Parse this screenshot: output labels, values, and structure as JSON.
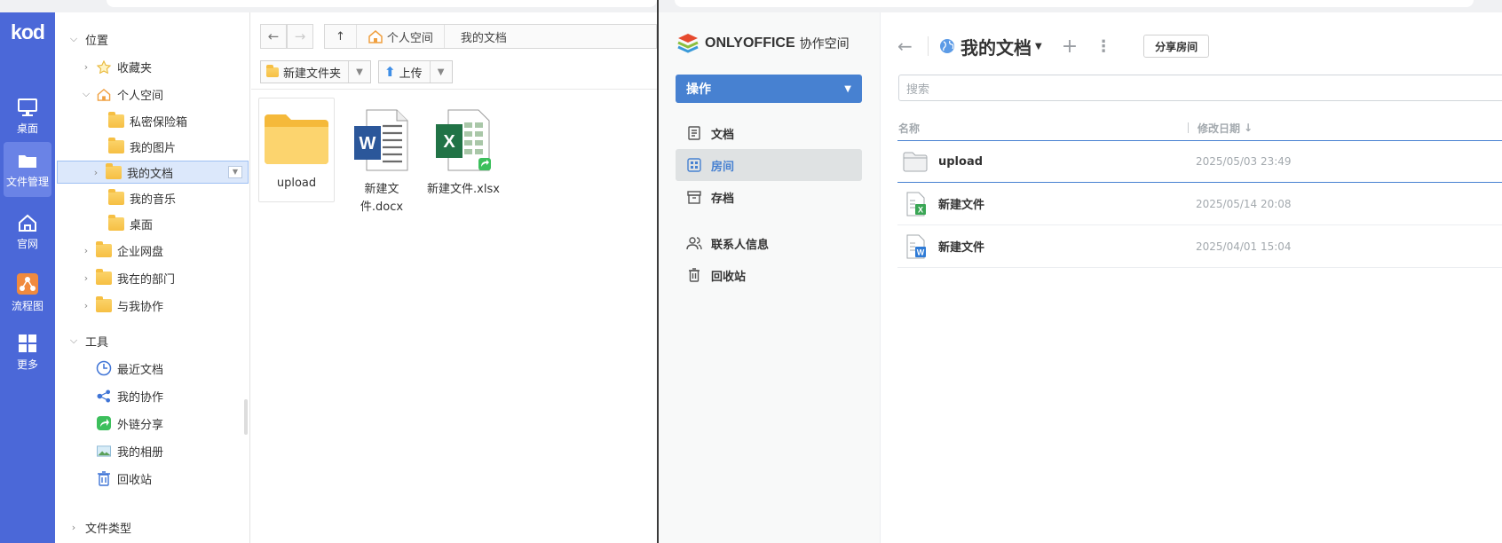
{
  "rail": {
    "logo": "kod",
    "items": [
      {
        "label": "桌面",
        "icon": "monitor-icon"
      },
      {
        "label": "文件管理",
        "icon": "folder-icon"
      },
      {
        "label": "官网",
        "icon": "home-icon"
      },
      {
        "label": "流程图",
        "icon": "flowchart-icon"
      },
      {
        "label": "更多",
        "icon": "grid-icon"
      }
    ]
  },
  "tree": {
    "location_header": "位置",
    "favorites": "收藏夹",
    "personal_space": "个人空间",
    "private_vault": "私密保险箱",
    "my_pictures": "我的图片",
    "my_documents": "我的文档",
    "my_music": "我的音乐",
    "desktop": "桌面",
    "enterprise_disk": "企业网盘",
    "my_department": "我在的部门",
    "collab_with_me": "与我协作",
    "tools_header": "工具",
    "recent_docs": "最近文档",
    "my_collab": "我的协作",
    "external_share": "外链分享",
    "my_album": "我的相册",
    "recycle_bin": "回收站",
    "file_types": "文件类型"
  },
  "pane": {
    "breadcrumb": [
      "个人空间",
      "我的文档"
    ],
    "new_folder_label": "新建文件夹",
    "upload_label": "上传",
    "files": [
      {
        "name": "upload",
        "type": "folder"
      },
      {
        "name_line1": "新建文",
        "name_line2": "件.docx",
        "type": "docx"
      },
      {
        "name": "新建文件.xlsx",
        "type": "xlsx"
      }
    ]
  },
  "onlyoffice": {
    "brand": "ONLYOFFICE",
    "brand_sub": "协作空间",
    "actions_label": "操作",
    "nav": {
      "documents": "文档",
      "rooms": "房间",
      "archive": "存档",
      "contacts": "联系人信息",
      "trash": "回收站"
    },
    "title": "我的文档",
    "share_room": "分享房间",
    "search_placeholder": "搜索",
    "col_name": "名称",
    "col_modified": "修改日期",
    "rows": [
      {
        "name": "upload",
        "date": "2025/05/03 23:49",
        "type": "folder"
      },
      {
        "name": "新建文件",
        "date": "2025/05/14 20:08",
        "type": "xlsx"
      },
      {
        "name": "新建文件",
        "date": "2025/04/01 15:04",
        "type": "docx"
      }
    ]
  },
  "colors": {
    "rail_bg": "#4b68d8",
    "oo_accent": "#4781d1",
    "word_blue": "#2b579a",
    "excel_green": "#217346"
  }
}
